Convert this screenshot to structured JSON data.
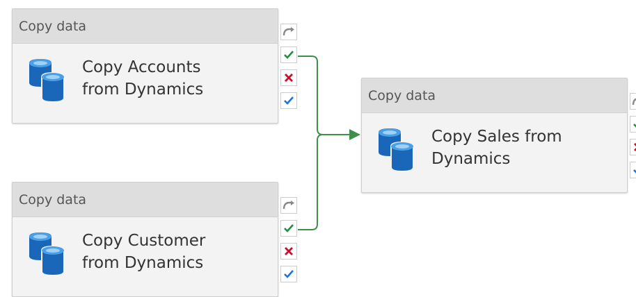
{
  "pipeline": {
    "activities": [
      {
        "type_label": "Copy data",
        "name": "Copy Accounts\nfrom Dynamics"
      },
      {
        "type_label": "Copy data",
        "name": "Copy Customer\nfrom Dynamics"
      },
      {
        "type_label": "Copy data",
        "name": "Copy Sales from\nDynamics"
      }
    ]
  },
  "icons": {
    "activity": "copy-data-database-icon",
    "handles": [
      "skip-icon",
      "success-check-icon",
      "failure-x-icon",
      "completion-check-icon"
    ]
  },
  "colors": {
    "success": "#1e8f3a",
    "failure": "#c8102e",
    "completion": "#1a73e8",
    "skip": "#888888",
    "connector": "#3d8f4a",
    "database": "#1a66b8"
  }
}
